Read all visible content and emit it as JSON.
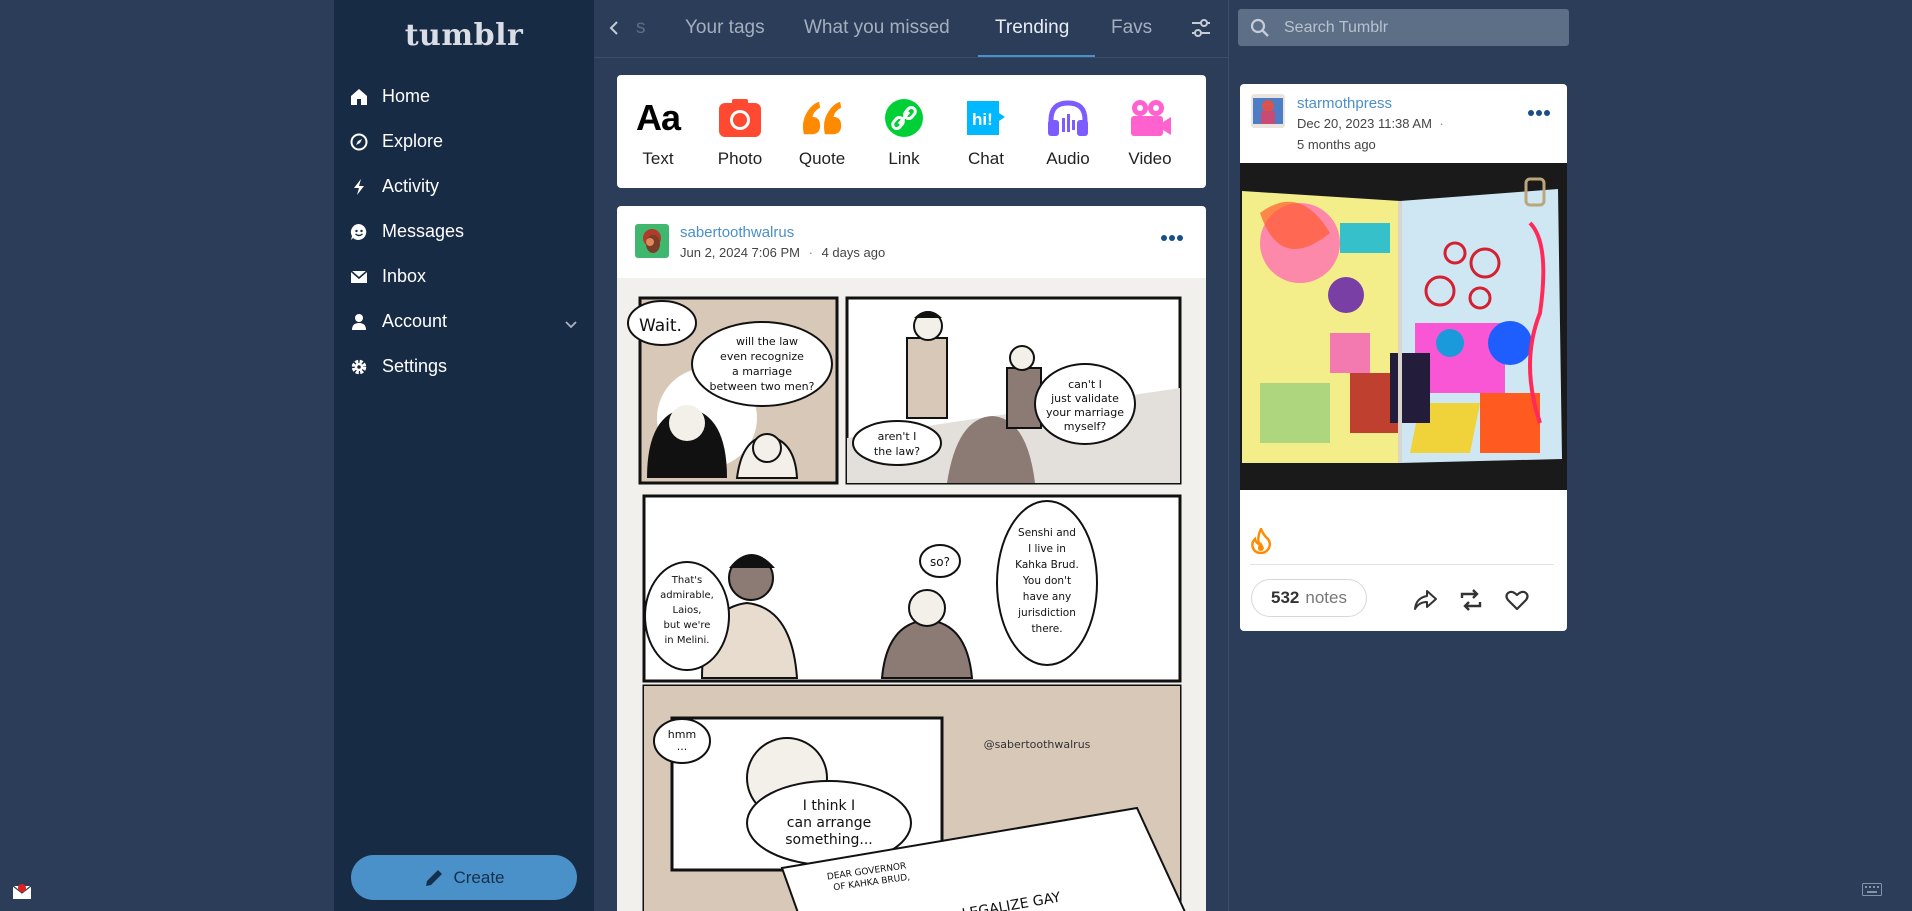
{
  "nav": {
    "logo": "tumblr",
    "items": [
      {
        "label": "Home",
        "icon": "home-icon"
      },
      {
        "label": "Explore",
        "icon": "compass-icon"
      },
      {
        "label": "Activity",
        "icon": "lightning-icon"
      },
      {
        "label": "Messages",
        "icon": "smiley-chat-icon"
      },
      {
        "label": "Inbox",
        "icon": "envelope-icon"
      },
      {
        "label": "Account",
        "icon": "person-icon"
      },
      {
        "label": "Settings",
        "icon": "gear-icon"
      }
    ],
    "create_label": "Create"
  },
  "tabs": {
    "partial": "s",
    "items": [
      "Your tags",
      "What you missed",
      "Trending",
      "Favs"
    ],
    "active": "Trending"
  },
  "post_types": [
    {
      "label": "Text",
      "icon": "text-icon",
      "color": "#000000"
    },
    {
      "label": "Photo",
      "icon": "camera-icon",
      "color": "#ff4930"
    },
    {
      "label": "Quote",
      "icon": "quote-icon",
      "color": "#ff8a00"
    },
    {
      "label": "Link",
      "icon": "link-icon",
      "color": "#00cf35"
    },
    {
      "label": "Chat",
      "icon": "chat-icon",
      "color": "#00b8ff"
    },
    {
      "label": "Audio",
      "icon": "headphones-icon",
      "color": "#7c5cff"
    },
    {
      "label": "Video",
      "icon": "video-camera-icon",
      "color": "#ff62ce"
    }
  ],
  "main_post": {
    "blog": "sabertoothwalrus",
    "date": "Jun 2, 2024 7:06 PM",
    "relative": "4 days ago",
    "comic_text": {
      "p1": "Wait.",
      "p1b": [
        "will the law",
        "even recognize",
        "a marriage",
        "between two men?"
      ],
      "p2a": [
        "aren't I",
        "the law?"
      ],
      "p2b": [
        "can't I",
        "just validate",
        "your marriage",
        "myself?"
      ],
      "p3a": [
        "That's",
        "admirable,",
        "Laios,",
        "but we're",
        "in Melini."
      ],
      "p3b": "so?",
      "p3c": [
        "Senshi and",
        "I live in",
        "Kahka Brud.",
        "You don't",
        "have any",
        "jurisdiction",
        "there."
      ],
      "credit": "@sabertoothwalrus",
      "p4a": [
        "hmm",
        "..."
      ],
      "p4b": [
        "I think I",
        "can arrange",
        "something..."
      ],
      "letter1": [
        "DEAR GOVERNOR",
        "OF KAHKA BRUD,"
      ],
      "letter2": "LEGALIZE GAY"
    }
  },
  "search": {
    "placeholder": "Search Tumblr"
  },
  "side_post": {
    "blog": "starmothpress",
    "date": "Dec 20, 2023 11:38 AM",
    "relative": "5 months ago",
    "notes_count": "532",
    "notes_label": "notes"
  },
  "colors": {
    "accent": "#4a90c9",
    "nav_bg": "#182b45",
    "page_bg": "#2b3d58",
    "fire": "#ff8a00"
  }
}
